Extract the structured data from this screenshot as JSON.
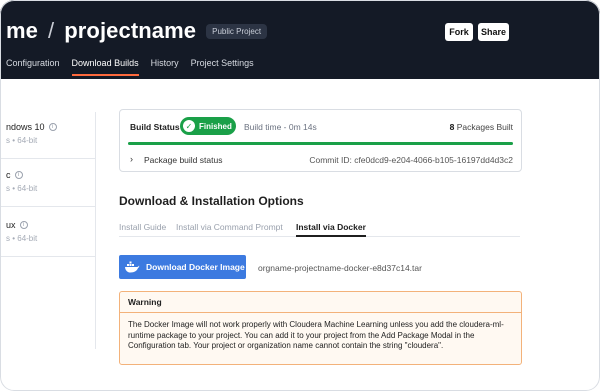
{
  "header": {
    "title_user": "me",
    "title_sep": "/",
    "title_project": "projectname",
    "badge": "Public Project",
    "fork_label": "Fork",
    "share_label": "Share",
    "tabs": [
      "Configuration",
      "Download Builds",
      "History",
      "Project Settings"
    ],
    "active_tab": "Download Builds"
  },
  "sidebar": {
    "items": [
      {
        "name": "ndows 10",
        "sub": "s • 64-bit"
      },
      {
        "name": "c",
        "sub": "s • 64-bit"
      },
      {
        "name": "ux",
        "sub": "s • 64-bit"
      }
    ]
  },
  "build": {
    "label": "Build Status",
    "status": "Finished",
    "time": "Build time - 0m 14s",
    "packages_count": "8",
    "packages_label": "Packages Built",
    "progress_fraction": 1.0,
    "package_status_label": "Package build status",
    "commit": "Commit ID: cfe0dcd9-e204-4066-b105-16197dd4d3c2"
  },
  "download": {
    "title": "Download & Installation Options",
    "tabs": [
      "Install Guide",
      "Install via Command Prompt",
      "Install via Docker"
    ],
    "active_tab": "Install via Docker",
    "button_label": "Download Docker Image",
    "image_name": "orgname-projectname-docker-e8d37c14.tar"
  },
  "warning": {
    "title": "Warning",
    "body": "The Docker Image will not work properly with Cloudera Machine Learning unless you add the cloudera-ml-runtime package to your project. You can add it to your project from the Add Package Modal in the Configuration tab. Your project or organization name cannot contain the string \"cloudera\"."
  },
  "colors": {
    "header_bg": "#141a26",
    "accent_tab": "#ff6a3d",
    "success": "#1aa048",
    "primary_button": "#3c7ae0",
    "warning_border": "#f3b27a"
  }
}
